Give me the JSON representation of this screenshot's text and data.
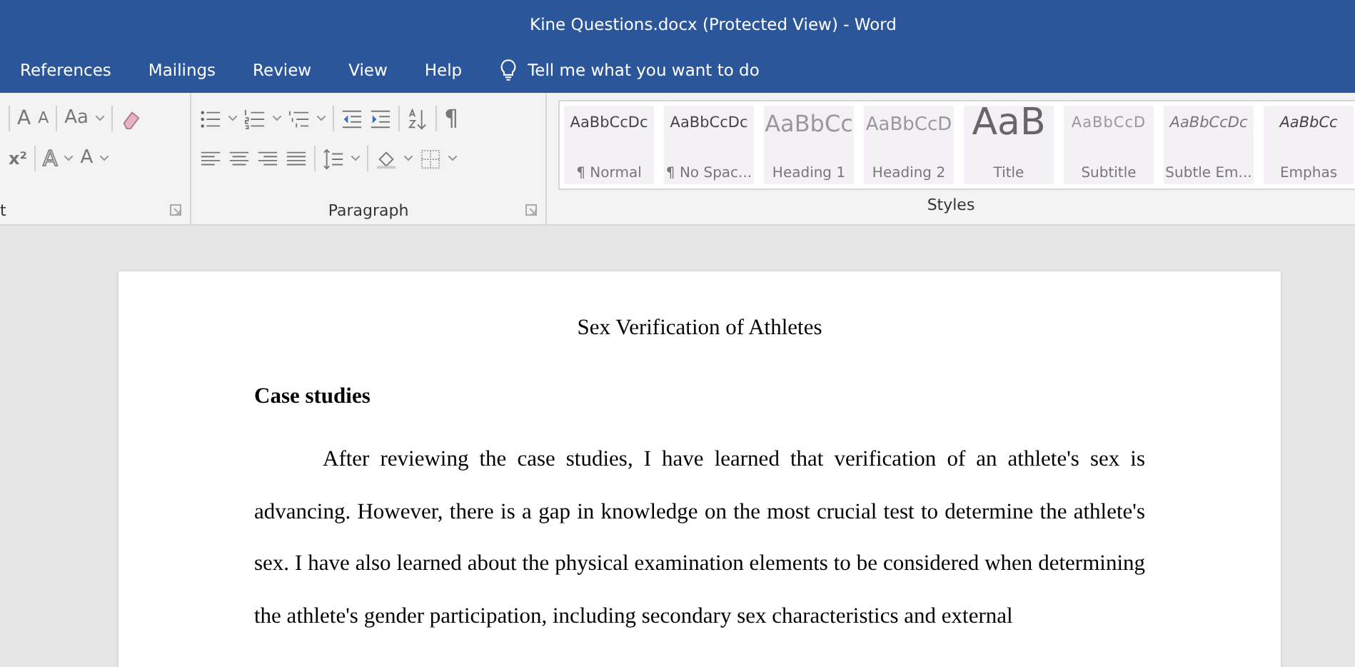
{
  "window": {
    "title": "Kine Questions.docx (Protected View)  -  Word"
  },
  "tabs": [
    {
      "label": "References",
      "selected": false
    },
    {
      "label": "Mailings",
      "selected": false
    },
    {
      "label": "Review",
      "selected": false
    },
    {
      "label": "View",
      "selected": false
    },
    {
      "label": "Help",
      "selected": false
    }
  ],
  "tell_me": {
    "placeholder": "Tell me what you want to do"
  },
  "font_group": {
    "label": "t",
    "row_1": [
      "A",
      "A",
      "Aa"
    ],
    "row_2": [
      "x²",
      "A",
      "A"
    ]
  },
  "paragraph_group": {
    "label": "Paragraph",
    "pilcrow": "¶"
  },
  "styles_group": {
    "label": "Styles",
    "styles": [
      {
        "sample": "AaBbCcDc",
        "name": "¶ Normal",
        "kind": "body"
      },
      {
        "sample": "AaBbCcDc",
        "name": "¶ No Spac...",
        "kind": "body"
      },
      {
        "sample": "AaBbCc",
        "name": "Heading 1",
        "kind": "heading1"
      },
      {
        "sample": "AaBbCcD",
        "name": "Heading 2",
        "kind": "heading2"
      },
      {
        "sample": "AaB",
        "name": "Title",
        "kind": "title"
      },
      {
        "sample": "AaBbCcD",
        "name": "Subtitle",
        "kind": "subtitle"
      },
      {
        "sample": "AaBbCcDc",
        "name": "Subtle Em...",
        "kind": "subtle"
      },
      {
        "sample": "AaBbCc",
        "name": "Emphas",
        "kind": "emphasis"
      }
    ]
  },
  "document": {
    "title": "Sex Verification of Athletes",
    "heading": "Case studies",
    "paragraph": "After reviewing the case studies, I have learned that verification of an athlete's sex is advancing. However, there is a gap in knowledge on the most crucial test to determine the athlete's sex. I have also learned about the physical examination elements to be considered when determining the athlete's gender participation, including secondary sex characteristics and external"
  }
}
